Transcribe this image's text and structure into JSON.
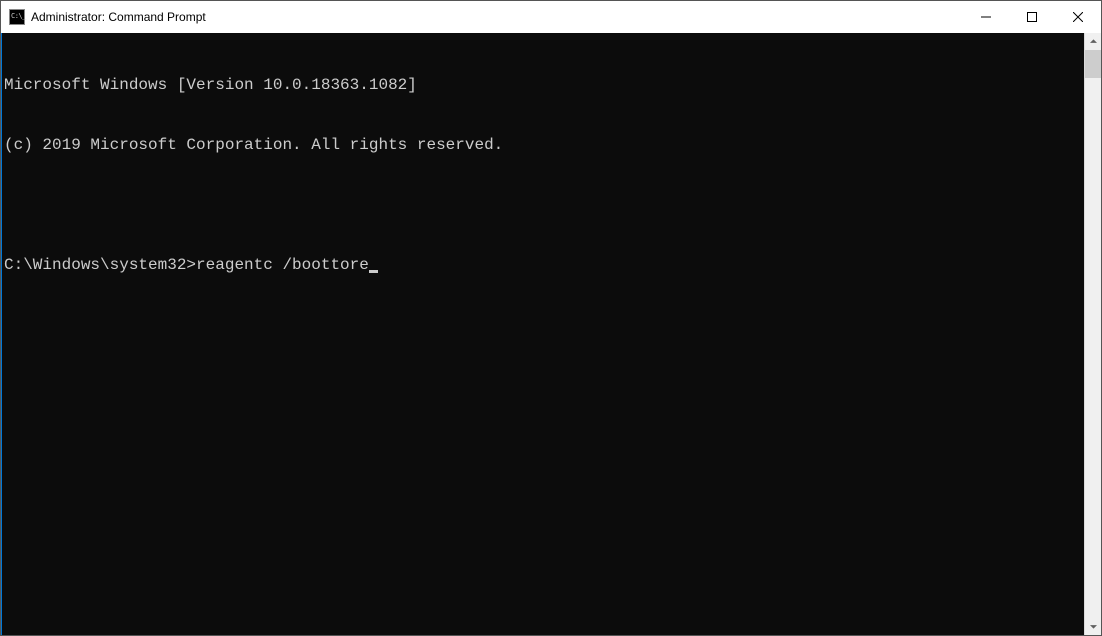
{
  "titlebar": {
    "title": "Administrator: Command Prompt"
  },
  "terminal": {
    "line1": "Microsoft Windows [Version 10.0.18363.1082]",
    "line2": "(c) 2019 Microsoft Corporation. All rights reserved.",
    "prompt": "C:\\Windows\\system32>",
    "command": "reagentc /boottore"
  }
}
